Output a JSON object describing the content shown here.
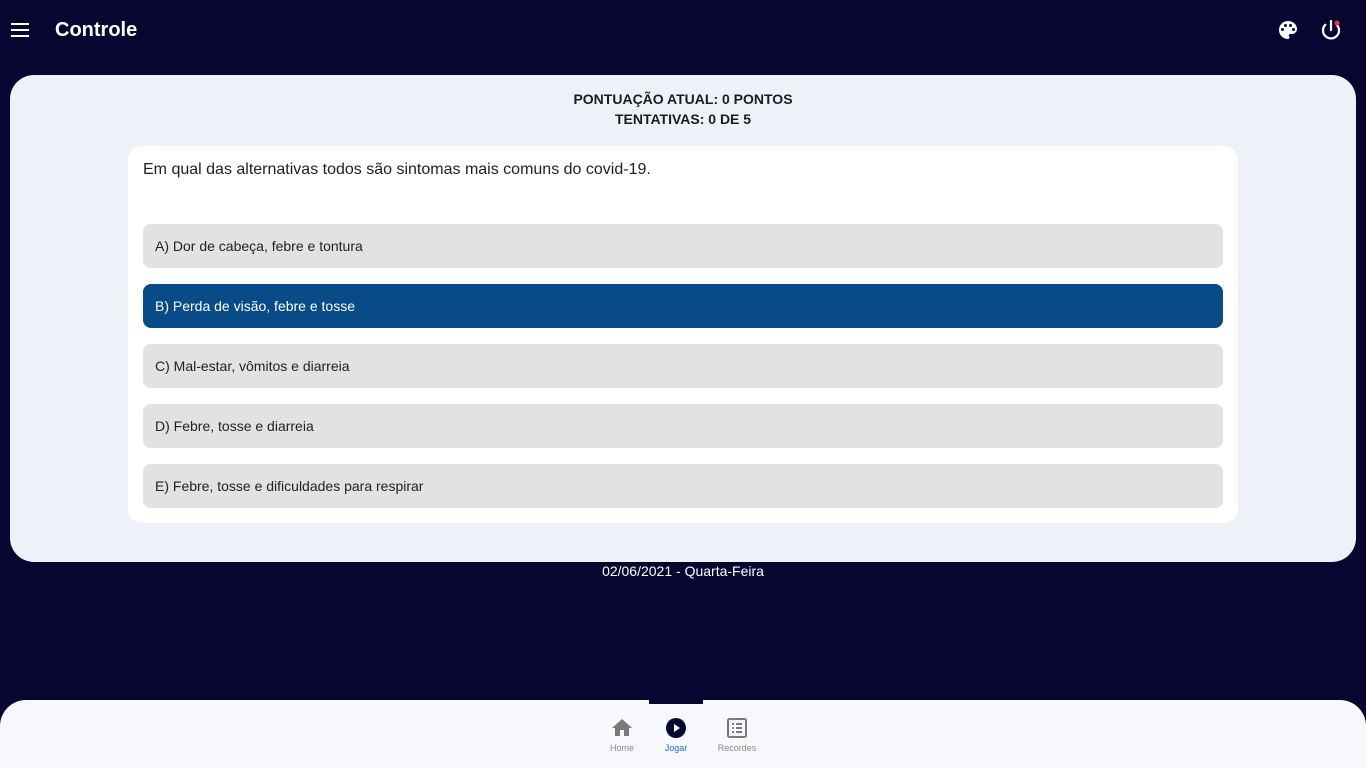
{
  "header": {
    "title": "Controle",
    "menu_icon": "menu-icon",
    "palette_icon": "palette-icon",
    "power_icon": "power-icon"
  },
  "quiz": {
    "score_text": "PONTUAÇÃO ATUAL: 0 PONTOS",
    "attempts_text": "TENTATIVAS: 0 DE 5",
    "question": "Em qual das alternativas todos são sintomas mais comuns do covid-19.",
    "options": [
      {
        "label": "A) Dor de cabeça, febre e tontura",
        "selected": false
      },
      {
        "label": "B) Perda de visão, febre e tosse",
        "selected": true
      },
      {
        "label": "C) Mal-estar, vômitos e diarreia",
        "selected": false
      },
      {
        "label": "D) Febre, tosse e diarreia",
        "selected": false
      },
      {
        "label": "E) Febre, tosse e dificuldades para respirar",
        "selected": false
      }
    ],
    "selected_color": "#084b86"
  },
  "date_text": "02/06/2021 - Quarta-Feira",
  "bottom_nav": {
    "items": [
      {
        "label": "Home",
        "icon": "home-icon",
        "active": false
      },
      {
        "label": "Jogar",
        "icon": "play-circle-icon",
        "active": true
      },
      {
        "label": "Recordes",
        "icon": "list-icon",
        "active": false
      }
    ],
    "active_color": "#2a6bc8"
  },
  "colors": {
    "background": "#070630",
    "panel": "#eef1f7",
    "notification_dot": "#e53935"
  }
}
